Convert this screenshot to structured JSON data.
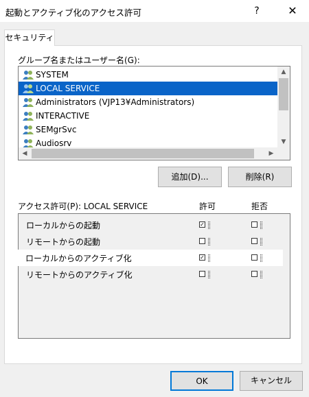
{
  "window": {
    "title": "起動とアクティブ化のアクセス許可",
    "help_label": "?",
    "close_label": "✕"
  },
  "tabs": [
    {
      "label": "セキュリティ"
    }
  ],
  "group_list": {
    "label": "グループ名またはユーザー名(G):",
    "items": [
      {
        "label": "SYSTEM",
        "icon": "user-group-icon"
      },
      {
        "label": "LOCAL SERVICE",
        "icon": "user-group-icon",
        "selected": true
      },
      {
        "label": "Administrators (VJP13¥Administrators)",
        "icon": "user-group-icon"
      },
      {
        "label": "INTERACTIVE",
        "icon": "user-group-icon"
      },
      {
        "label": "SEMgrSvc",
        "icon": "user-group-icon"
      },
      {
        "label": "Audiosrv",
        "icon": "user-group-icon"
      }
    ]
  },
  "buttons": {
    "add": "追加(D)...",
    "remove": "削除(R)",
    "ok": "OK",
    "cancel": "キャンセル"
  },
  "permissions": {
    "label": "アクセス許可(P): LOCAL SERVICE",
    "allow_header": "許可",
    "deny_header": "拒否",
    "rows": [
      {
        "name": "ローカルからの起動",
        "allow": true,
        "deny": false
      },
      {
        "name": "リモートからの起動",
        "allow": false,
        "deny": false
      },
      {
        "name": "ローカルからのアクティブ化",
        "allow": true,
        "deny": false,
        "highlighted": true
      },
      {
        "name": "リモートからのアクティブ化",
        "allow": false,
        "deny": false
      }
    ]
  },
  "colors": {
    "selection": "#0a64c8",
    "ok_border": "#0078d7"
  }
}
